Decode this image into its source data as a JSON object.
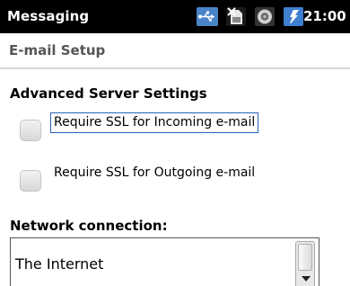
{
  "status_bar": {
    "app_title": "Messaging",
    "time": "21:00",
    "icons": [
      "usb-sync-icon",
      "no-sim-icon",
      "radio-off-icon",
      "charging-icon"
    ],
    "background": "#000000"
  },
  "header": {
    "title": "E-mail Setup"
  },
  "advanced": {
    "section_title": "Advanced Server Settings",
    "incoming_ssl": {
      "label": "Require SSL for Incoming e-mail",
      "checked": false
    },
    "outgoing_ssl": {
      "label": "Require SSL for Outgoing e-mail",
      "checked": false
    }
  },
  "network": {
    "label": "Network connection:",
    "selected": "The Internet"
  },
  "colors": {
    "focus_border": "#2a62b8",
    "header_text": "#555555"
  }
}
